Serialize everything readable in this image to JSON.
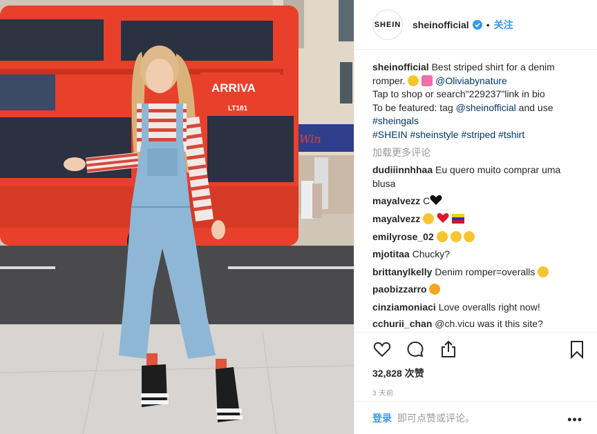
{
  "post": {
    "username": "sheinofficial",
    "avatar_text": "SHEIN",
    "follow_label": "关注",
    "separator": "•",
    "caption": {
      "username": "sheinofficial",
      "text1": " Best striped shirt for a denim romper. ",
      "mention1": "@Oliviabynature",
      "line2": "Tap to shop or search\"229237\"link in bio",
      "line3_prefix": "To be featured: tag ",
      "mention2": "@sheinofficial",
      "line3_suffix": " and use",
      "tag1": "#sheingals",
      "tags_line": [
        "#SHEIN",
        "#sheinstyle",
        "#striped",
        "#tshirt"
      ]
    },
    "load_more": "加载更多评论",
    "comments": [
      {
        "user": "dudiiinnhhaa",
        "text": " Eu quero muito comprar uma blusa",
        "emojis": []
      },
      {
        "user": "mayalvezz",
        "text": " C",
        "emojis": [
          "black-heart"
        ]
      },
      {
        "user": "mayalvezz",
        "text": " ",
        "emojis": [
          "crying-face",
          "red-heart",
          "venezuela-flag"
        ]
      },
      {
        "user": "emilyrose_02",
        "text": " ",
        "emojis": [
          "heart-eyes",
          "heart-eyes",
          "heart-eyes"
        ]
      },
      {
        "user": "mjotitaa",
        "text": " Chucky?",
        "emojis": []
      },
      {
        "user": "brittanylkelly",
        "text": " Denim romper=overalls ",
        "emojis": [
          "tears-of-joy"
        ]
      },
      {
        "user": "paobizzarro",
        "text": " ",
        "emojis": [
          "heart-eyes-cat"
        ]
      },
      {
        "user": "cinziamoniaci",
        "text": " Love overalls right now!",
        "emojis": []
      },
      {
        "user": "cchurii_chan",
        "text": " @ch.vicu was it this site?",
        "emojis": []
      }
    ],
    "likes": "32,828 次赞",
    "time_ago": "3 天前",
    "login_label": "登录",
    "login_hint": "即可点赞或评论。",
    "more_menu": "•••",
    "bus_text": {
      "operator": "ARRIVA",
      "route": "LT181",
      "shop": "2 Win"
    },
    "colors": {
      "accent": "#3897f0",
      "link": "#003569",
      "muted": "#999999",
      "bus_red": "#e8402b"
    }
  }
}
